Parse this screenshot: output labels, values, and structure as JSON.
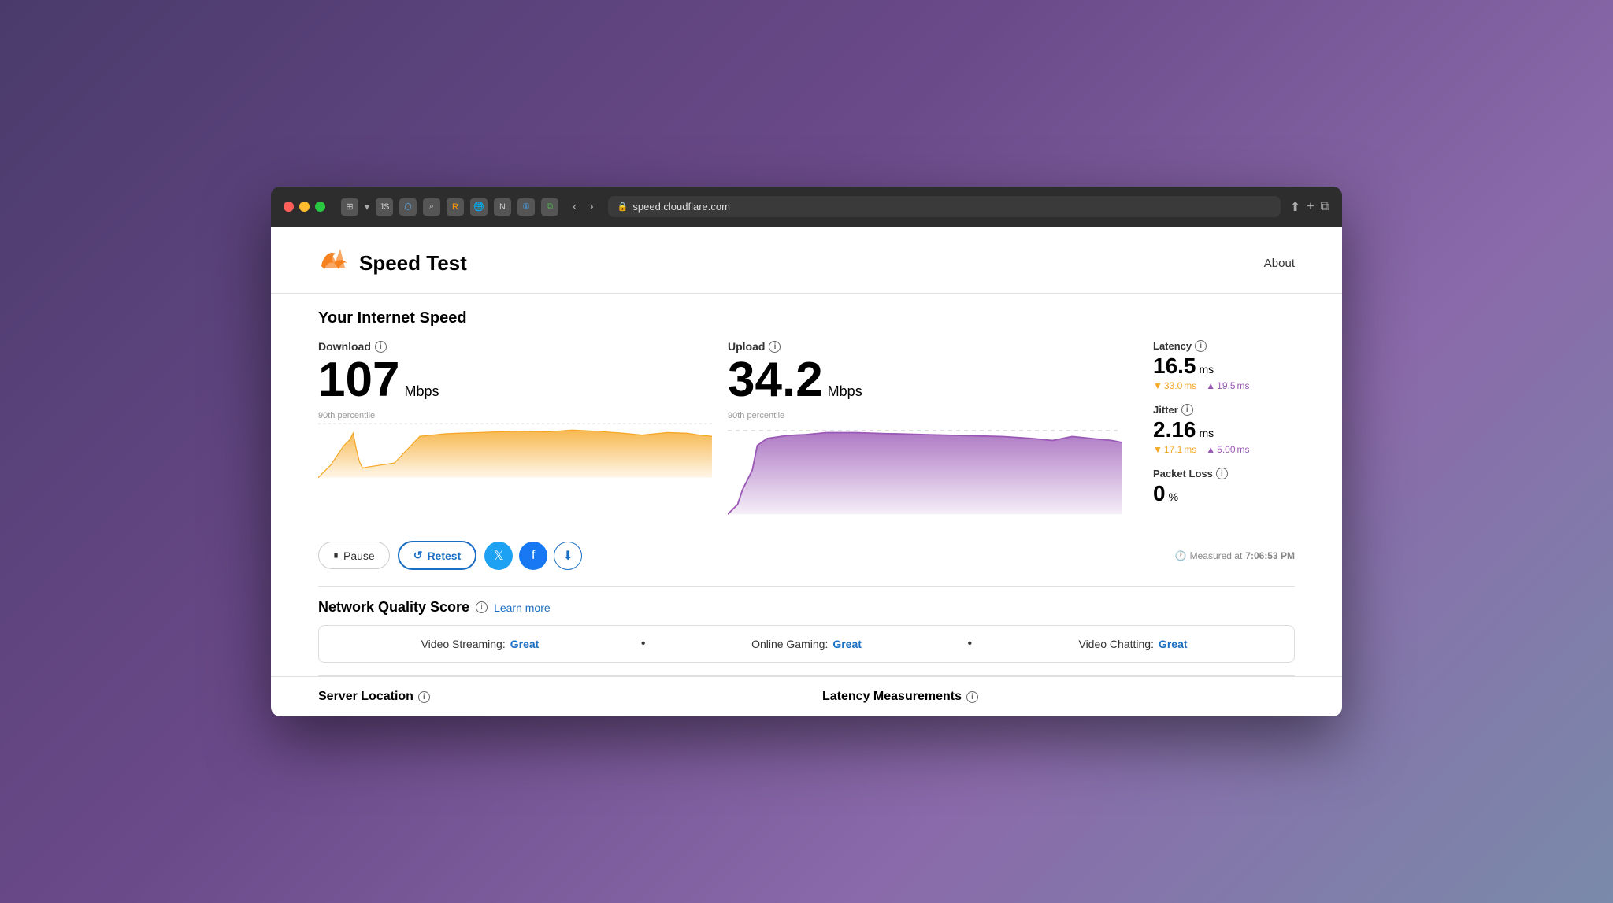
{
  "browser": {
    "url": "speed.cloudflare.com",
    "back_label": "‹",
    "forward_label": "›",
    "reload_label": "↻"
  },
  "header": {
    "logo_emoji": "🦅",
    "title": "Speed Test",
    "about_label": "About"
  },
  "internet_speed": {
    "section_title": "Your Internet Speed",
    "download": {
      "label": "Download",
      "value": "107",
      "unit": "Mbps",
      "percentile_label": "90th percentile"
    },
    "upload": {
      "label": "Upload",
      "value": "34.2",
      "unit": "Mbps",
      "percentile_label": "90th percentile"
    },
    "latency": {
      "label": "Latency",
      "value": "16.5",
      "unit": "ms",
      "down_value": "33.0",
      "down_unit": "ms",
      "up_value": "19.5",
      "up_unit": "ms"
    },
    "jitter": {
      "label": "Jitter",
      "value": "2.16",
      "unit": "ms",
      "down_value": "17.1",
      "down_unit": "ms",
      "up_value": "5.00",
      "up_unit": "ms"
    },
    "packet_loss": {
      "label": "Packet Loss",
      "value": "0",
      "unit": "%"
    }
  },
  "actions": {
    "pause_label": "Pause",
    "retest_label": "Retest",
    "measured_label": "Measured at",
    "measured_time": "7:06:53 PM"
  },
  "network_quality": {
    "title": "Network Quality Score",
    "learn_more_label": "Learn more",
    "video_streaming_label": "Video Streaming:",
    "video_streaming_value": "Great",
    "online_gaming_label": "Online Gaming:",
    "online_gaming_value": "Great",
    "video_chatting_label": "Video Chatting:",
    "video_chatting_value": "Great"
  },
  "bottom": {
    "server_location_label": "Server Location",
    "latency_measurements_label": "Latency Measurements"
  },
  "colors": {
    "accent_blue": "#1a6fc4",
    "orange_download": "#f5a623",
    "purple_upload": "#9b59b6",
    "great_color": "#1a6fc4"
  }
}
